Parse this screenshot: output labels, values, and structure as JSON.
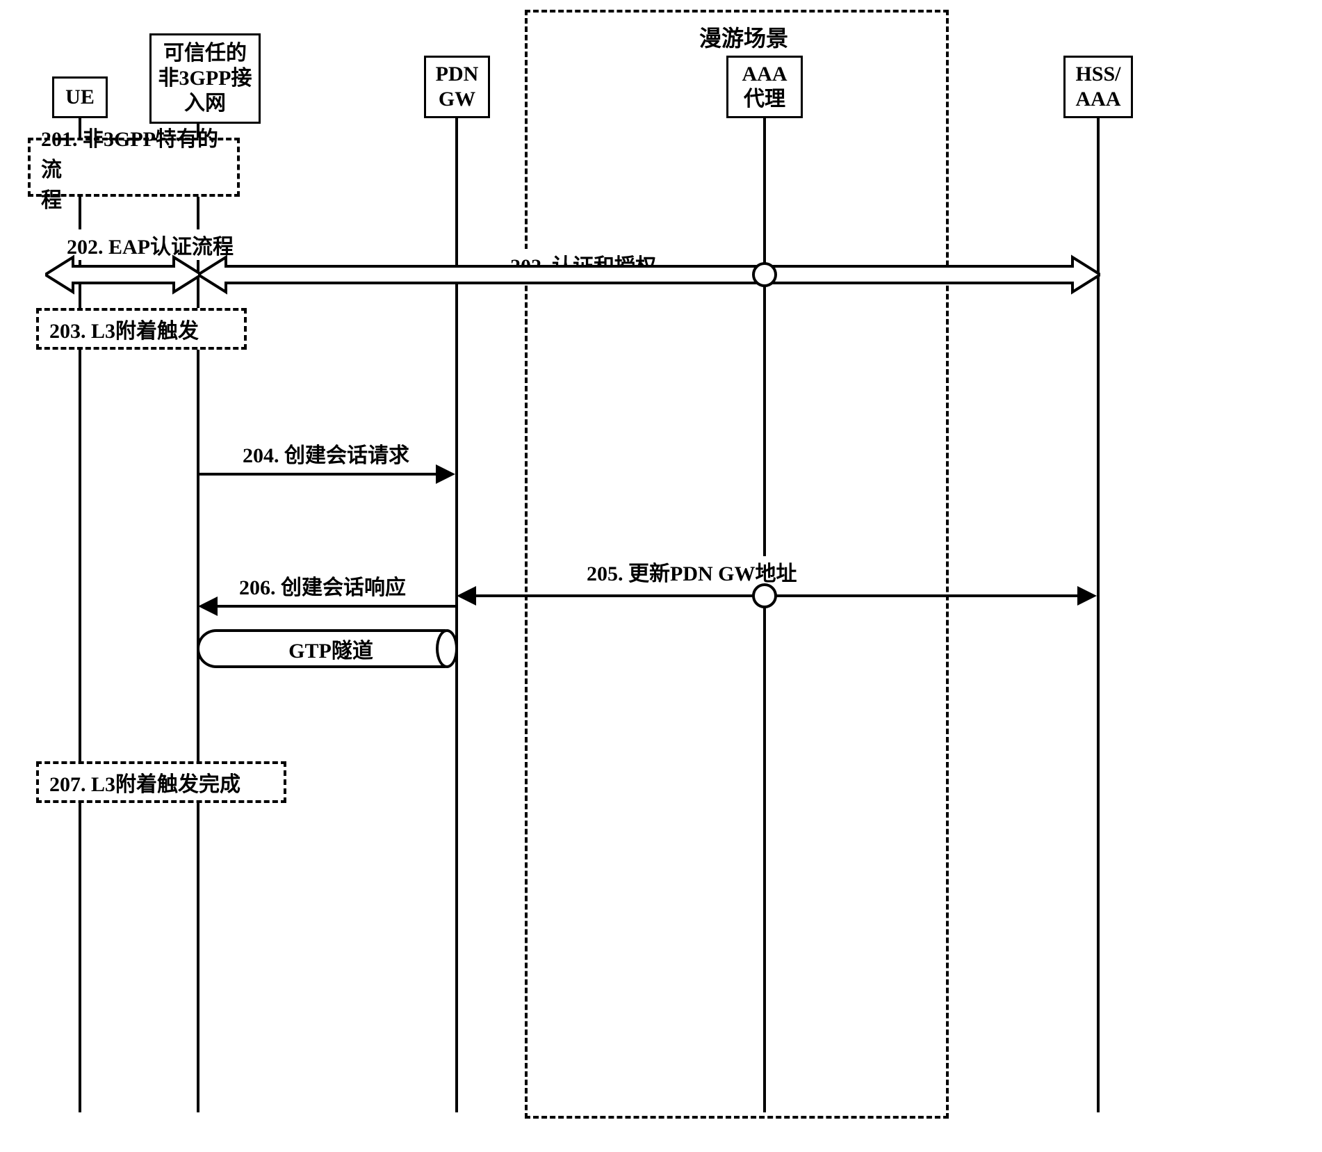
{
  "participants": {
    "ue": "UE",
    "trusted_non3gpp": "可信任的\n非3GPP接\n入网",
    "pdn_gw": "PDN\nGW",
    "aaa_proxy": "AAA\n代理",
    "hss_aaa": "HSS/\nAAA"
  },
  "roaming_title": "漫游场景",
  "steps": {
    "s201": "201. 非3GPP特有的流\n程",
    "s202a": "202. EAP认证流程",
    "s202b": "202. 认证和授权",
    "s203": "203. L3附着触发",
    "s204": "204. 创建会话请求",
    "s205": "205. 更新PDN GW地址",
    "s206": "206. 创建会话响应",
    "tunnel": "GTP隧道",
    "s207": "207. L3附着触发完成"
  }
}
